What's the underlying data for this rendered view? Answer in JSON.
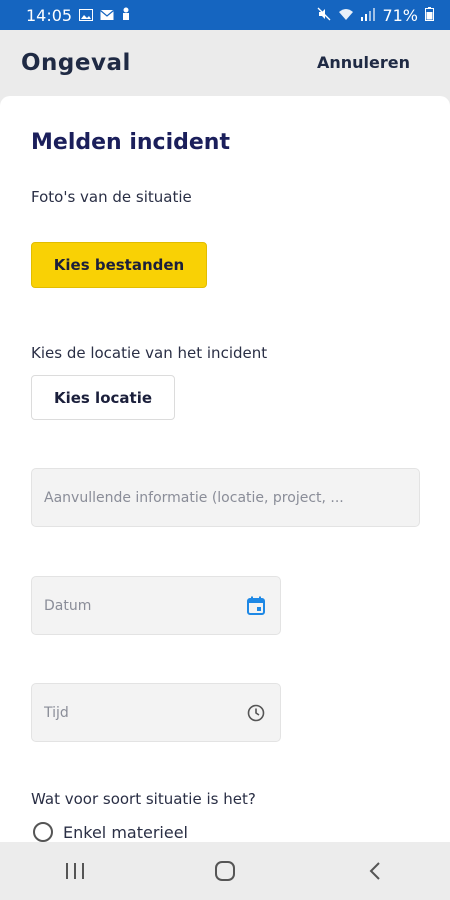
{
  "status": {
    "time": "14:05",
    "battery": "71%"
  },
  "appbar": {
    "title": "Ongeval",
    "cancel": "Annuleren"
  },
  "form": {
    "title": "Melden incident",
    "photos_label": "Foto's van de situatie",
    "choose_files": "Kies bestanden",
    "location_label": "Kies de locatie van het incident",
    "choose_location": "Kies locatie",
    "extra_info_placeholder": "Aanvullende informatie (locatie, project, ...",
    "date_placeholder": "Datum",
    "time_placeholder": "Tijd",
    "situation_question": "Wat voor soort situatie is het?",
    "situation_options": [
      "Enkel materieel"
    ]
  },
  "colors": {
    "statusbar": "#1565c0",
    "accent_yellow": "#f9d105",
    "icon_blue": "#1e88e5"
  }
}
